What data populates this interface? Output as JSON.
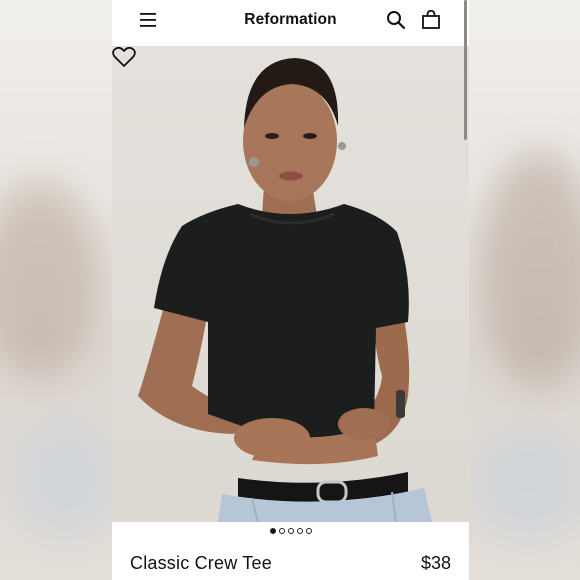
{
  "header": {
    "brand": "Reformation",
    "menu_icon": "hamburger-menu-icon",
    "search_icon": "search-icon",
    "bag_icon": "shopping-bag-icon"
  },
  "gallery": {
    "image_count": 5,
    "active_index": 0,
    "wishlist_icon": "heart-icon"
  },
  "product": {
    "name": "Classic Crew Tee",
    "price": "$38"
  },
  "colors": {
    "text": "#111111",
    "background": "#ffffff",
    "tee": "#1c1d1d",
    "denim": "#b7c6d6"
  }
}
